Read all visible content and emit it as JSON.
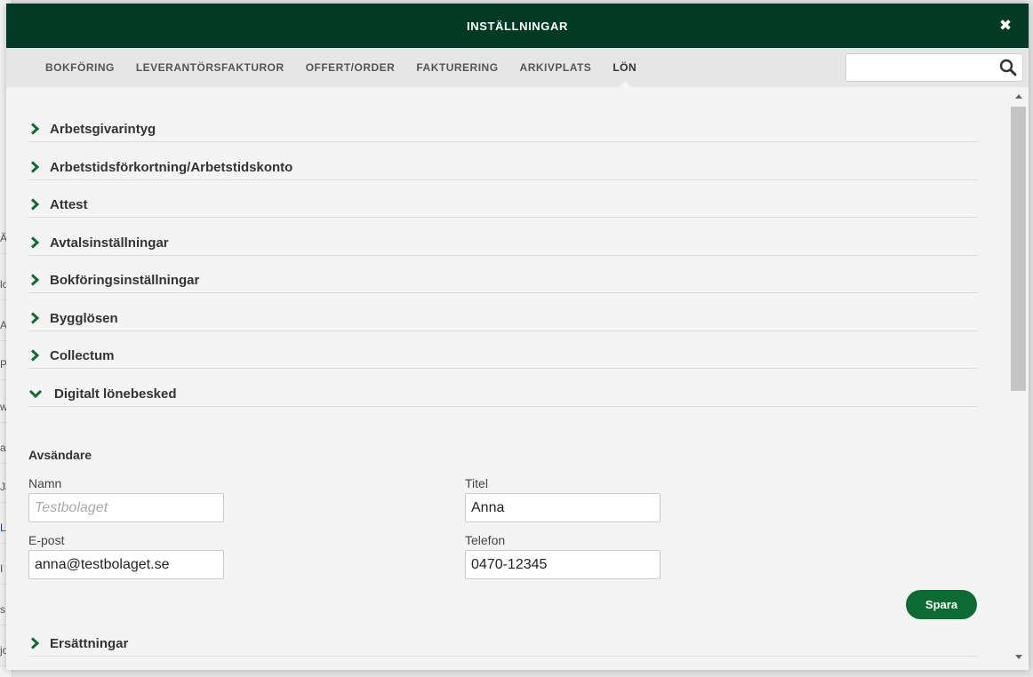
{
  "background_fragments": [
    "Ä",
    "lo",
    "A",
    "Pa",
    "w",
    "a",
    "Jä",
    "L",
    "I",
    "s",
    "jo"
  ],
  "modal": {
    "title": "INSTÄLLNINGAR",
    "close_symbol": "✖"
  },
  "nav": {
    "tabs": [
      {
        "label": "BOKFÖRING",
        "active": false
      },
      {
        "label": "LEVERANTÖRSFAKTUROR",
        "active": false
      },
      {
        "label": "OFFERT/ORDER",
        "active": false
      },
      {
        "label": "FAKTURERING",
        "active": false
      },
      {
        "label": "ARKIVPLATS",
        "active": false
      },
      {
        "label": "LÖN",
        "active": true
      }
    ],
    "search": {
      "value": "",
      "placeholder": ""
    }
  },
  "sections": [
    {
      "label": "Arbetsgivarintyg",
      "expanded": false
    },
    {
      "label": "Arbetstidsförkortning/Arbetstidskonto",
      "expanded": false
    },
    {
      "label": "Attest",
      "expanded": false
    },
    {
      "label": "Avtalsinställningar",
      "expanded": false
    },
    {
      "label": "Bokföringsinställningar",
      "expanded": false
    },
    {
      "label": "Bygglösen",
      "expanded": false
    },
    {
      "label": "Collectum",
      "expanded": false
    },
    {
      "label": "Digitalt lönebesked",
      "expanded": true
    },
    {
      "label": "Ersättningar",
      "expanded": false
    }
  ],
  "digital_payslip": {
    "subheading": "Avsändare",
    "fields": {
      "name": {
        "label": "Namn",
        "value": "",
        "placeholder": "Testbolaget"
      },
      "title": {
        "label": "Titel",
        "value": "Anna",
        "placeholder": ""
      },
      "email": {
        "label": "E-post",
        "value": "anna@testbolaget.se",
        "placeholder": ""
      },
      "phone": {
        "label": "Telefon",
        "value": "0470-12345",
        "placeholder": ""
      }
    },
    "save_label": "Spara"
  },
  "colors": {
    "header_bg": "#013a24",
    "accent_green": "#0c6b33",
    "nav_bg": "#e6e6e6",
    "content_bg": "#f4f4f4"
  }
}
